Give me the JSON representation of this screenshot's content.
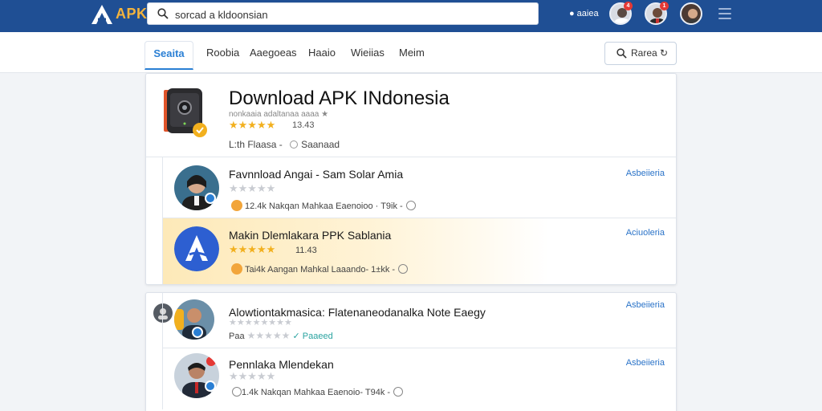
{
  "header": {
    "logo_text": "APK",
    "search_value": "sorcad a kldoonsian",
    "search_placeholder": "sorcad a kldoonsian",
    "link_label": "aaiea",
    "notif_badge_1": "4",
    "notif_badge_2": "1"
  },
  "tabs": [
    "Seaita",
    "Roobia",
    "Aaegoeas",
    "Haaio",
    "Wieiias",
    "Meim"
  ],
  "find_button": "Rarea",
  "hero": {
    "title": "Download APK INdonesia",
    "subtitle": "nonkaaia adaltanaa aaaa ★",
    "rating_text": "13.43",
    "rating_stars": 5,
    "meta_left": "L:th Flaasa",
    "meta_sep": "-",
    "meta_right": "Saanaad"
  },
  "rows": [
    {
      "title": "Favnnload Angai - Sam Solar Amia",
      "stars_on": 0,
      "meta": "12.4k  Nakqan Mahkaa Eaenoioo · T9ik  -",
      "link": "Asbeiieria"
    },
    {
      "title": "Makin Dlemlakara PPK Sablania",
      "stars_on": 5,
      "rating": "11.43",
      "meta": "Tai4k  Aangan Mahkal Laaando- 1±kk  -",
      "link": "Aciuoleria"
    },
    {
      "title": "Alowtiontakmasica: Flatenaneodanalka Note Eaegy",
      "stars_on": 0,
      "meta_left": "Paa",
      "meta_right": "Paaeed",
      "link": "Asbeiieria"
    },
    {
      "title": "Pennlaka Mlendekan",
      "stars_on": 0,
      "meta": "1.4k  Nakqan Mahkaa Eaenoio- T94k  -",
      "link": "Asbeiieria"
    }
  ],
  "colors": {
    "topbar": "#1f4f94",
    "accent": "#2a7fd4",
    "star": "#f2b01e",
    "highlight": "#fde9b8"
  }
}
